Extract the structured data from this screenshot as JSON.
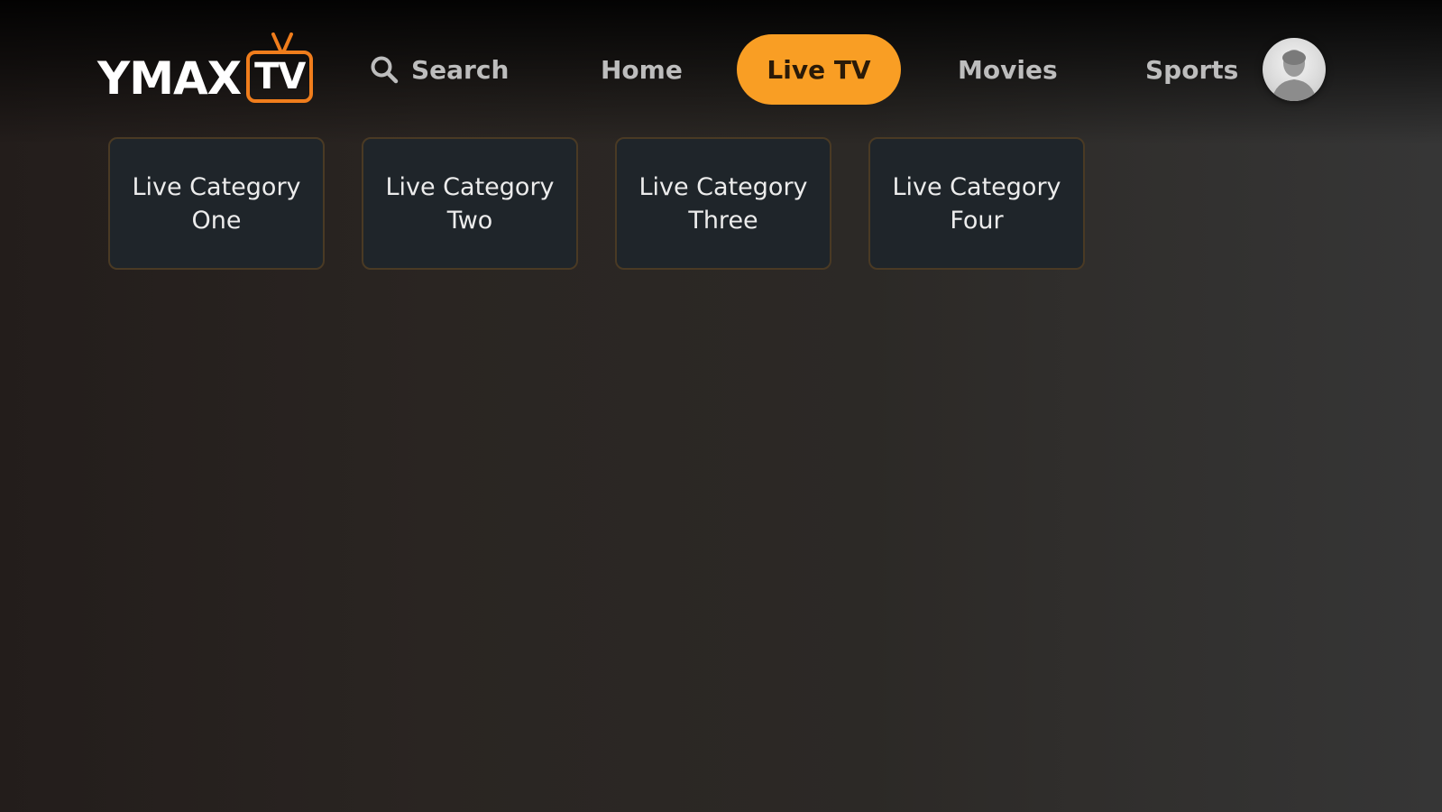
{
  "brand": {
    "name": "YMAX",
    "tv_badge": "TV",
    "accent_color": "#f07d1c"
  },
  "nav": {
    "search_label": "Search",
    "search_icon": "search-icon",
    "items": [
      {
        "label": "Home",
        "active": false
      },
      {
        "label": "Live TV",
        "active": true
      },
      {
        "label": "Movies",
        "active": false
      },
      {
        "label": "Sports",
        "active": false
      }
    ],
    "active_color": "#f99e24"
  },
  "profile": {
    "icon": "avatar"
  },
  "categories": [
    {
      "label": "Live Category One"
    },
    {
      "label": "Live Category Two"
    },
    {
      "label": "Live Category Three"
    },
    {
      "label": "Live Category Four"
    }
  ]
}
